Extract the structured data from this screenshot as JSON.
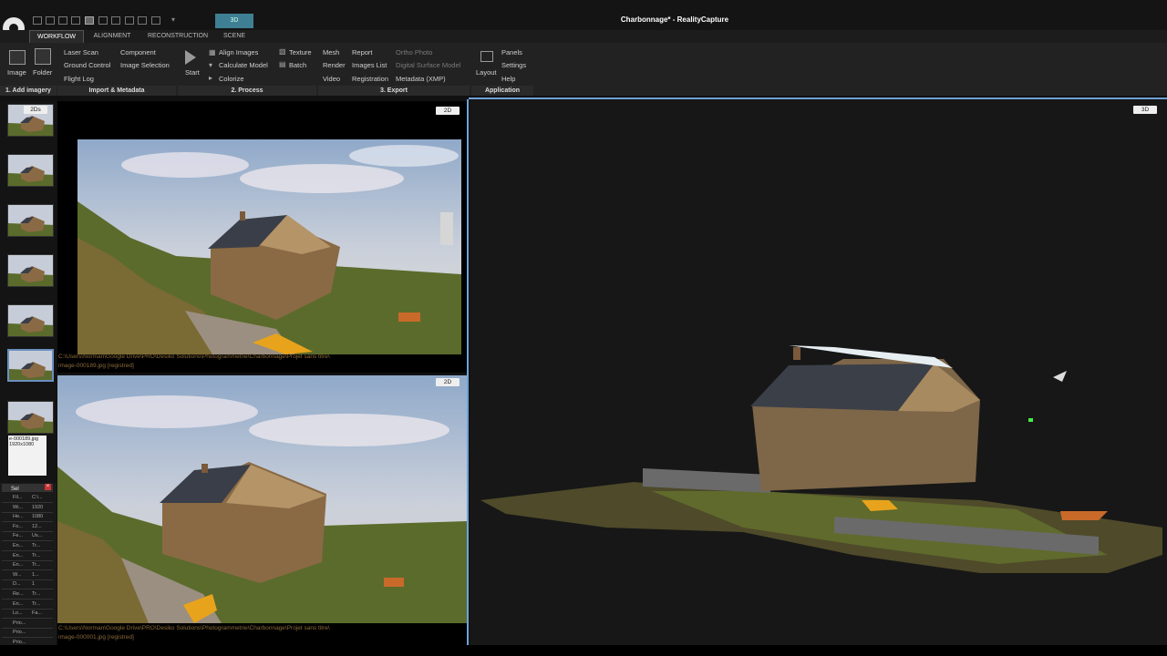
{
  "app": {
    "title": "Charbonnage* - RealityCapture",
    "mode_tab": "3D",
    "rc_label": "RC"
  },
  "ribbon_tabs": [
    {
      "label": "WORKFLOW"
    },
    {
      "label": "ALIGNMENT"
    },
    {
      "label": "RECONSTRUCTION"
    },
    {
      "label": "SCENE"
    }
  ],
  "ribbon": {
    "add_imagery": {
      "image_label": "Image",
      "folder_label": "Folder",
      "group_label": "1. Add imagery"
    },
    "import": {
      "laser_scan": "Laser Scan",
      "ground_control": "Ground Control",
      "flight_log": "Flight Log",
      "component": "Component",
      "image_selection": "Image Selection",
      "group_label": "Import & Metadata"
    },
    "process": {
      "start": "Start",
      "align_images": "Align Images",
      "calculate_model": "Calculate Model",
      "colorize": "Colorize",
      "texture": "Texture",
      "batch": "Batch",
      "group_label": "2. Process"
    },
    "export": {
      "mesh": "Mesh",
      "render": "Render",
      "video": "Video",
      "report": "Report",
      "images_list": "Images List",
      "registration": "Registration",
      "ortho_photo": "Ortho Photo",
      "dsm": "Digital Surface Model",
      "metadata": "Metadata (XMP)",
      "group_label": "3. Export"
    },
    "application": {
      "layout": "Layout",
      "panels": "Panels",
      "settings": "Settings",
      "help": "Help",
      "group_label": "Application"
    }
  },
  "strip": {
    "badge": "2Ds",
    "tooltip_name": "e-000189.jpg",
    "tooltip_size": "1920x1080"
  },
  "props": {
    "header": "Sel",
    "rows": [
      {
        "k": "Fil...",
        "v": "C:\\..."
      },
      {
        "k": "Wi...",
        "v": "1920"
      },
      {
        "k": "He...",
        "v": "1080"
      },
      {
        "k": "Fo...",
        "v": "12..."
      },
      {
        "k": "Fe...",
        "v": "Us..."
      },
      {
        "k": "En...",
        "v": "Tr..."
      },
      {
        "k": "En...",
        "v": "Tr..."
      },
      {
        "k": "En...",
        "v": "Tr..."
      },
      {
        "k": "W...",
        "v": "1..."
      },
      {
        "k": "D...",
        "v": "1"
      },
      {
        "k": "Re...",
        "v": "Tr..."
      },
      {
        "k": "En...",
        "v": "Tr..."
      },
      {
        "k": "Lo...",
        "v": "Fa..."
      },
      {
        "k": "Prio...",
        "v": ""
      },
      {
        "k": "Prio...",
        "v": ""
      },
      {
        "k": "Prio...",
        "v": ""
      }
    ]
  },
  "view_top": {
    "badge": "2D",
    "path": "C:\\Users\\Norman\\Google Drive\\PRO\\Desiko Solutions\\Photogrammetrie\\Charbonnage\\Projet sans titre\\",
    "file": "image-000189.jpg [registred]"
  },
  "view_bottom": {
    "badge": "2D",
    "path": "C:\\Users\\Norman\\Google Drive\\PRO\\Desiko Solutions\\Photogrammetrie\\Charbonnage\\Projet sans titre\\",
    "file": "image-000001.jpg [registred]"
  },
  "view_3d": {
    "badge": "3D"
  },
  "colors": {
    "accent": "#3e7f93",
    "separator": "#6ea2d8",
    "path_text": "#8a6a3a"
  }
}
